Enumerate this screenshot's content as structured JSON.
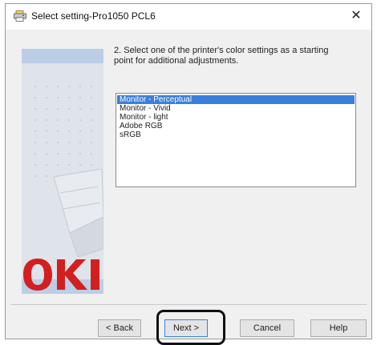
{
  "window": {
    "title": "Select setting-Pro1050 PCL6",
    "close_glyph": "✕",
    "icon": "printer-app-icon"
  },
  "instruction": "2. Select one of the printer's color settings as a starting point for additional adjustments.",
  "color_settings": {
    "selected": "Monitor - Perceptual",
    "items": [
      {
        "label": "Monitor - Perceptual",
        "selected": true
      },
      {
        "label": "Monitor - Vivid",
        "selected": false
      },
      {
        "label": "Monitor - light",
        "selected": false
      },
      {
        "label": "Adobe RGB",
        "selected": false
      },
      {
        "label": "sRGB",
        "selected": false
      }
    ]
  },
  "brand": {
    "logo_text": "OKI",
    "logo_color": "#d21f1f"
  },
  "buttons": {
    "back": "< Back",
    "next": "Next >",
    "cancel": "Cancel",
    "help": "Help"
  },
  "colors": {
    "selection": "#3b7fd8",
    "side_panel": "#dfe3ea",
    "side_band": "#bccde6",
    "highlight_outline": "#111111"
  }
}
